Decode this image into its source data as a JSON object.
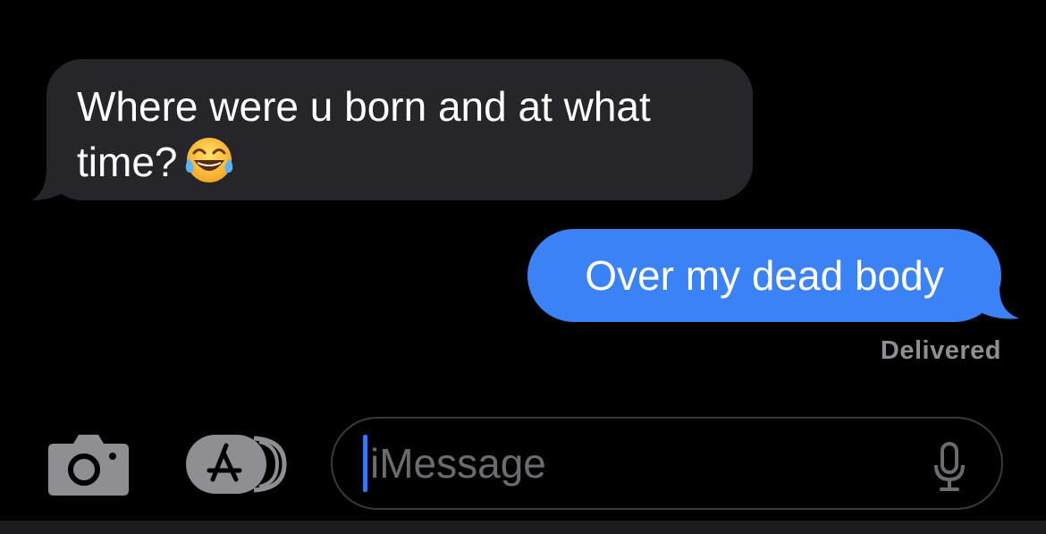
{
  "conversation": {
    "messages": [
      {
        "direction": "incoming",
        "line1": "Where were u born and at what",
        "line2": "time?",
        "emoji": "face-with-tears-of-joy"
      },
      {
        "direction": "outgoing",
        "text": "Over my dead body",
        "status": "Delivered"
      }
    ]
  },
  "input_bar": {
    "camera_icon": "camera-icon",
    "apps_icon": "app-store-icon",
    "placeholder": "iMessage",
    "mic_icon": "microphone-icon"
  },
  "colors": {
    "background": "#000000",
    "incoming_bubble": "#26252a",
    "outgoing_bubble": "#3b82f6",
    "status_text": "#8e8e93",
    "caret": "#3478f6"
  }
}
